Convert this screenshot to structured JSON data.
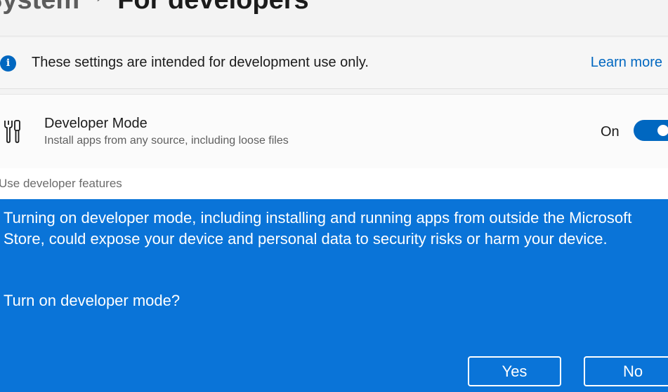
{
  "header": {
    "breadcrumb_parent": "System",
    "breadcrumb_separator": "›",
    "breadcrumb_current": "For developers"
  },
  "info_bar": {
    "icon": "info-icon",
    "message": "These settings are intended for development use only.",
    "link_label": "Learn more"
  },
  "developer_mode": {
    "icon": "tools-icon",
    "title": "Developer Mode",
    "description": "Install apps from any source, including loose files",
    "state_label": "On",
    "enabled": true
  },
  "dialog": {
    "title": "Use developer features",
    "message": "Turning on developer mode, including installing and running apps from outside the Microsoft Store, could expose your device and personal data to security risks or harm your device.",
    "question": "Turn on developer mode?",
    "yes_label": "Yes",
    "no_label": "No",
    "background_color": "#0a74d8"
  },
  "colors": {
    "accent": "#0067c0"
  }
}
